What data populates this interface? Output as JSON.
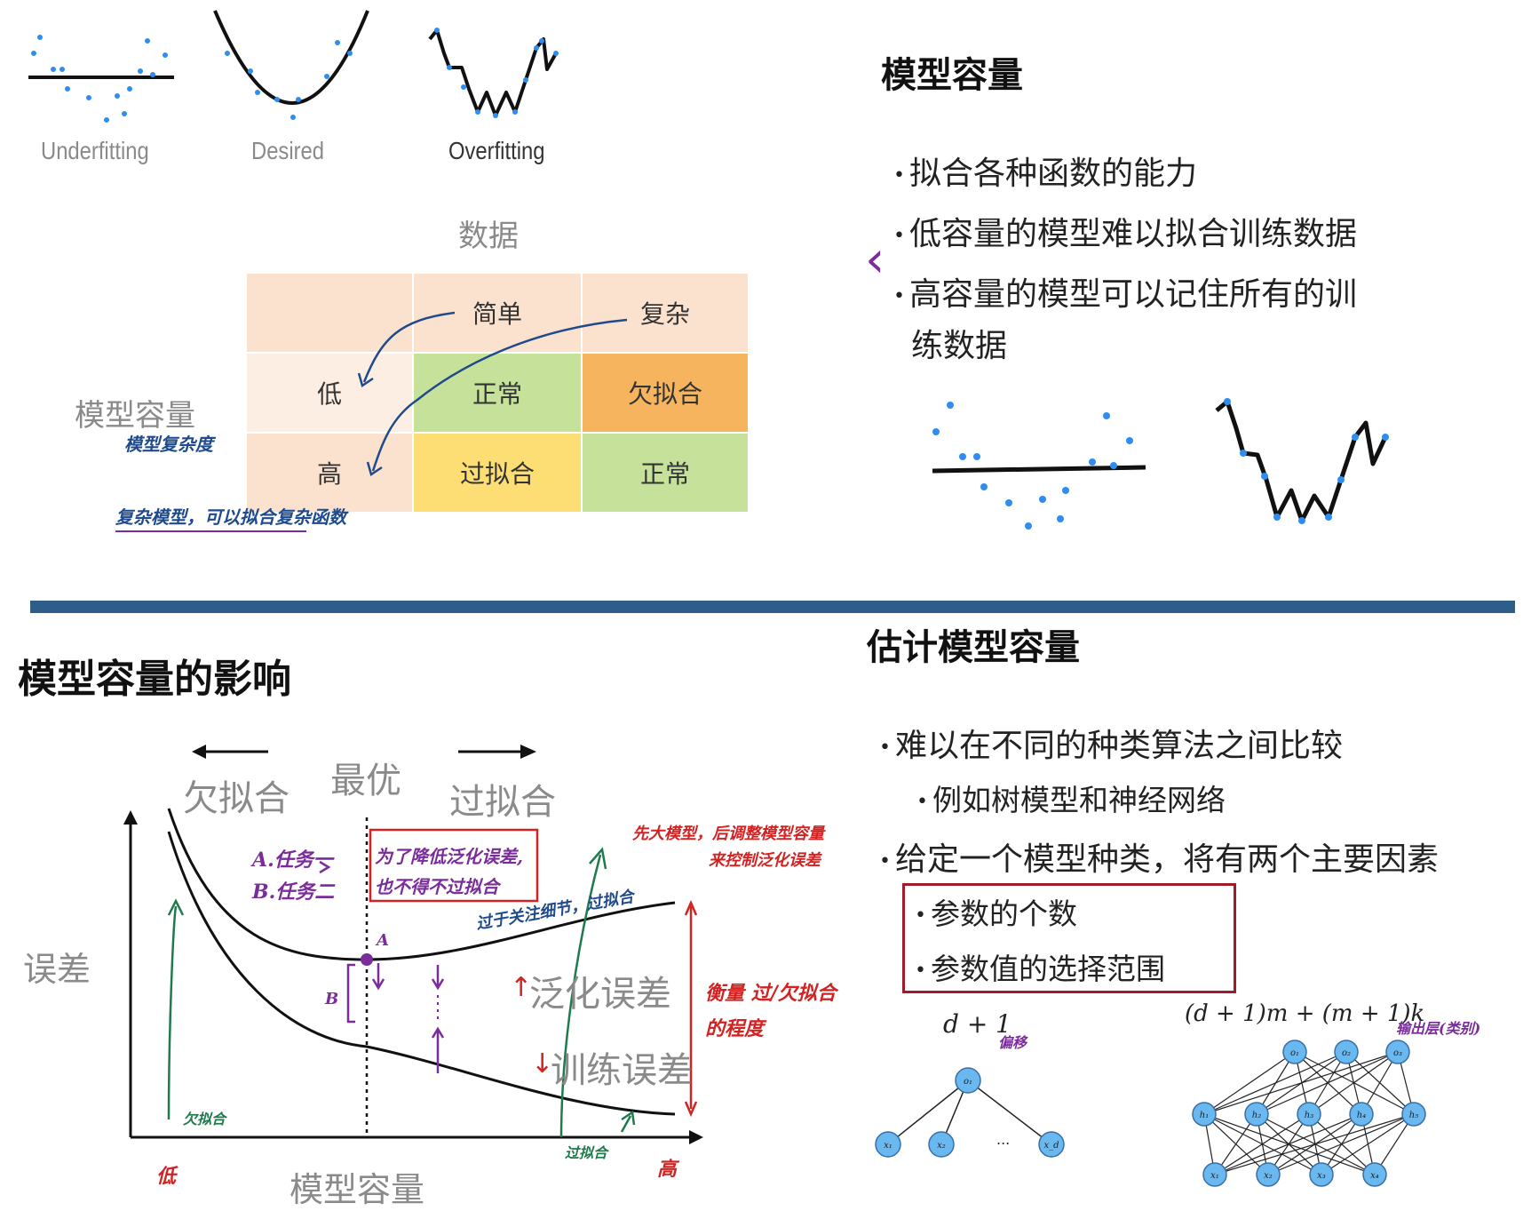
{
  "top_left": {
    "fit_labels": [
      "Underfitting",
      "Desired",
      "Overfitting"
    ],
    "data_header": "数据",
    "capacity_axis_label": "模型容量",
    "capacity_note": "模型复杂度",
    "table": {
      "col_headers": [
        "简单",
        "复杂"
      ],
      "row_headers": [
        "低",
        "高"
      ],
      "cells": [
        [
          "正常",
          "欠拟合"
        ],
        [
          "过拟合",
          "正常"
        ]
      ],
      "colors": {
        "header": "#fbe2cf",
        "row_header": "#fdeee3",
        "normal": "#c6e29a",
        "underfit": "#f5b45d",
        "overfit": "#fcde74"
      }
    },
    "bottom_note": "复杂模型，可以拟合复杂函数"
  },
  "top_right": {
    "title": "模型容量",
    "bullets": [
      "拟合各种函数的能力",
      "低容量的模型难以拟合训练数据",
      "高容量的模型可以记住所有的训"
    ],
    "bullet_continuation": "练数据",
    "chevron": "‹"
  },
  "bottom_left": {
    "title": "模型容量的影响",
    "arrows": {
      "left": "欠拟合",
      "middle": "最优",
      "right": "过拟合"
    },
    "ylabel": "误差",
    "xlabel": "模型容量",
    "curves": {
      "generalization": "泛化误差",
      "training": "训练误差"
    },
    "annotations": {
      "task_a": "A.任务一",
      "task_b": "B.任务二",
      "reduce_gen": "为了降低泛化误差,",
      "overfit_ok": "也不得不过拟合",
      "enlarge": "先大模型，后调整模型容量",
      "control": "来控制泛化误差",
      "too_focus": "过于关注细节，过拟合",
      "measure": "衡量 过/欠拟合",
      "degree": "的程度",
      "point_a": "A",
      "b_label": "B",
      "underfit_small": "欠拟合",
      "overfit_small": "过拟合",
      "low": "低",
      "high": "高"
    }
  },
  "bottom_right": {
    "title": "估计模型容量",
    "bullets": [
      "难以在不同的种类算法之间比较",
      "例如树模型和神经网络",
      "给定一个模型种类，将有两个主要因素",
      "参数的个数",
      "参数值的选择范围"
    ],
    "formula_left": "d + 1",
    "formula_left_note": "偏移",
    "formula_right": "(d + 1)m + (m + 1)k",
    "formula_right_note": "输出层(类别)",
    "left_net": {
      "output": "o₁",
      "inputs": [
        "x₁",
        "x₂",
        "x_d"
      ],
      "ellipsis": "..."
    },
    "right_net": {
      "outputs": [
        "o₁",
        "o₂",
        "o₃"
      ],
      "hidden": [
        "h₁",
        "h₂",
        "h₃",
        "h₄",
        "h₅"
      ],
      "inputs": [
        "x₁",
        "x₂",
        "x₃",
        "x₄"
      ]
    }
  },
  "colors": {
    "divider": "#2f5d8a",
    "point": "#2e8ef0",
    "node": "#6ab8f0",
    "green_ink": "#1f7a4c",
    "purple_ink": "#7a2c9a",
    "red_ink": "#d22222",
    "blue_ink": "#1f4a8c",
    "box": "#a01c2a"
  }
}
